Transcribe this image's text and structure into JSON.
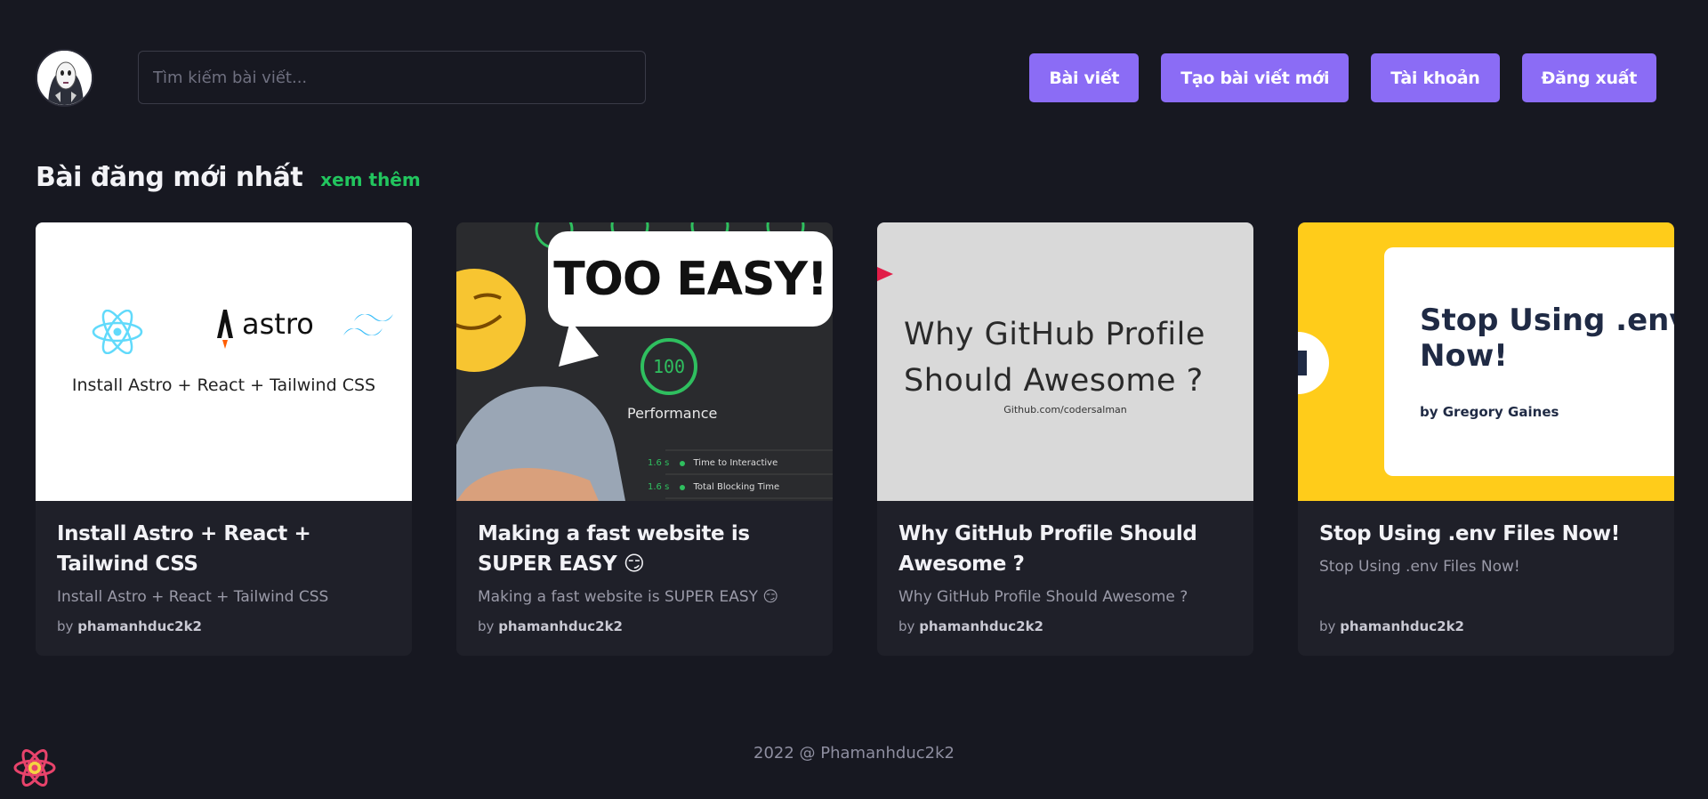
{
  "header": {
    "search_placeholder": "Tìm kiếm bài viết...",
    "nav": [
      "Bài viết",
      "Tạo bài viết mới",
      "Tài khoản",
      "Đăng xuất"
    ]
  },
  "section": {
    "title": "Bài đăng mới nhất",
    "see_more": "xem thêm"
  },
  "cards": [
    {
      "title": "Install Astro + React + Tailwind CSS",
      "description": "Install Astro + React + Tailwind CSS",
      "author_prefix": "by",
      "author": "phamanhduc2k2",
      "thumb": {
        "logo_text": "astro",
        "caption": "Install Astro + React + Tailwind CSS"
      }
    },
    {
      "title": "Making a fast website is SUPER EASY 😏",
      "description": "Making a fast website is SUPER EASY 😏",
      "author_prefix": "by",
      "author": "phamanhduc2k2",
      "thumb": {
        "bubble": "TOO EASY!",
        "score": "100",
        "score_label": "Performance",
        "metrics": [
          {
            "value": "1.6 s",
            "label": "Time to Interactive"
          },
          {
            "value": "1.6 s",
            "label": "Total Blocking Time"
          }
        ]
      }
    },
    {
      "title": "Why GitHub Profile Should Awesome ?",
      "description": "Why GitHub Profile Should Awesome ?",
      "author_prefix": "by",
      "author": "phamanhduc2k2",
      "thumb": {
        "headline_1": "Why GitHub Profile",
        "headline_2": "Should Awesome ?",
        "sub": "Github.com/codersalman"
      }
    },
    {
      "title": "Stop Using .env Files Now!",
      "description": "Stop Using .env Files Now!",
      "author_prefix": "by",
      "author": "phamanhduc2k2",
      "thumb": {
        "headline_1": "Stop Using .env f",
        "headline_2": "Now!",
        "byline": "by Gregory Gaines"
      }
    }
  ],
  "footer": {
    "text": "2022 @ Phamanhduc2k2"
  },
  "colors": {
    "background": "#171821",
    "card": "#1f2029",
    "accent": "#8b6cf5",
    "link": "#22c55e"
  }
}
